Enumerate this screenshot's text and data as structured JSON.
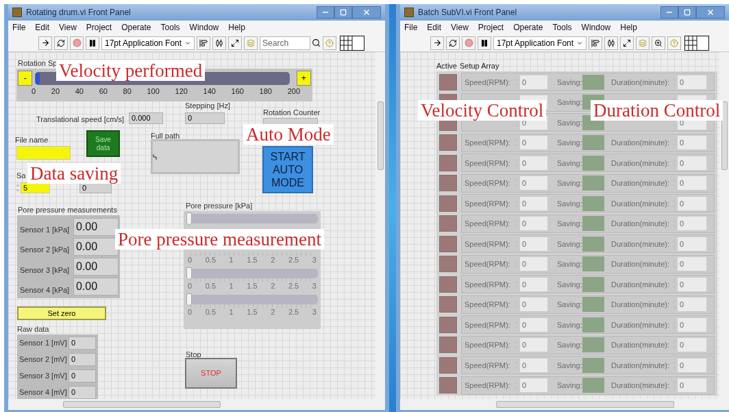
{
  "left_window": {
    "title": "Rotating drum.vi Front Panel",
    "menu": [
      "File",
      "Edit",
      "View",
      "Project",
      "Operate",
      "Tools",
      "Window",
      "Help"
    ],
    "toolbar": {
      "font": "17pt Application Font",
      "search": {
        "placeholder": "Search"
      }
    },
    "rotation_speed": {
      "label": "Rotation Sp",
      "minus": "-",
      "plus": "+",
      "level": 0,
      "ticks": [
        "0",
        "20",
        "40",
        "60",
        "80",
        "100",
        "120",
        "140",
        "160",
        "180",
        "200"
      ]
    },
    "translational_speed": {
      "label": "Translational speed [cm/s]",
      "value": "0.000"
    },
    "stepping": {
      "label": "Stepping [Hz]",
      "value": "0"
    },
    "rotation_counter": {
      "label": "Rotation Counter"
    },
    "file_name": {
      "label": "File name"
    },
    "save_button": "Save data",
    "full_path": {
      "label": "Full path"
    },
    "auto_button": "START AUTO MODE",
    "saves": {
      "label": "Sa",
      "value": "5",
      "value_2": "0"
    },
    "pore_measurements": {
      "title": "Pore pressure measurements",
      "sensors": [
        {
          "label": "Sensor 1 [kPa]",
          "value": "0.00"
        },
        {
          "label": "Sensor 2 [kPa]",
          "value": "0.00"
        },
        {
          "label": "Sensor 3 [kPa]",
          "value": "0.00"
        },
        {
          "label": "Sensor 4 [kPa]",
          "value": "0.00"
        }
      ]
    },
    "pore_pressure": {
      "label": "Pore pressure [kPa]",
      "sliders": [
        {
          "level": 0,
          "ticks": [
            "0",
            "0.5",
            "1",
            "1.5",
            "2",
            "2.5",
            "3"
          ]
        },
        {
          "level": 0,
          "ticks": [
            "0",
            "0.5",
            "1",
            "1.5",
            "2",
            "2.5",
            "3"
          ]
        },
        {
          "level": 0,
          "ticks": [
            "0",
            "0.5",
            "1",
            "1.5",
            "2",
            "2.5",
            "3"
          ]
        }
      ]
    },
    "set_zero": "Set zero",
    "raw_data": {
      "title": "Raw data",
      "sensors": [
        {
          "label": "Sensor 1 [mV]",
          "value": "0"
        },
        {
          "label": "Sensor 2 [mV]",
          "value": "0"
        },
        {
          "label": "Sensor 3 [mV]",
          "value": "0"
        },
        {
          "label": "Sensor 4 [mV]",
          "value": "0"
        }
      ]
    },
    "stop": {
      "label": "Stop",
      "button": "STOP"
    }
  },
  "right_window": {
    "title": "Batch SubVI.vi Front Panel",
    "menu": [
      "File",
      "Edit",
      "View",
      "Project",
      "Operate",
      "Tools",
      "Window",
      "Help"
    ],
    "toolbar": {
      "font": "17pt Application Font"
    },
    "active_label": "Active",
    "array_label": "Setup Array",
    "rows": [
      {
        "active": false,
        "speed_label": "Speed(RPM):",
        "speed_value": "0",
        "saving_label": "Saving:",
        "saving": false,
        "duration_label": "Duration(minute):",
        "duration_value": "0"
      },
      {
        "active": false,
        "saving_label": "Saving:",
        "saving": false
      },
      {
        "active": false,
        "speed_value": "0",
        "saving_label": "Saving:",
        "saving": false,
        "duration_value": "0"
      },
      {
        "active": false,
        "speed_label": "Speed(RPM):",
        "speed_value": "0",
        "saving_label": "Saving:",
        "saving": false,
        "duration_label": "Duration(minute):",
        "duration_value": "0"
      },
      {
        "active": false,
        "speed_label": "Speed(RPM):",
        "speed_value": "0",
        "saving_label": "Saving:",
        "saving": false,
        "duration_label": "Duration(minute):",
        "duration_value": "0"
      },
      {
        "active": false,
        "speed_label": "Speed(RPM):",
        "speed_value": "0",
        "saving_label": "Saving:",
        "saving": false,
        "duration_label": "Duration(minute):",
        "duration_value": "0"
      },
      {
        "active": false,
        "speed_label": "Speed(RPM):",
        "speed_value": "0",
        "saving_label": "Saving:",
        "saving": false,
        "duration_label": "Duration(minute):",
        "duration_value": "0"
      },
      {
        "active": false,
        "speed_label": "Speed(RPM):",
        "speed_value": "0",
        "saving_label": "Saving:",
        "saving": false,
        "duration_label": "Duration(minute):",
        "duration_value": "0"
      },
      {
        "active": false,
        "speed_label": "Speed(RPM):",
        "speed_value": "0",
        "saving_label": "Saving:",
        "saving": false,
        "duration_label": "Duration(minute):",
        "duration_value": "0"
      },
      {
        "active": false,
        "speed_label": "Speed(RPM):",
        "speed_value": "0",
        "saving_label": "Saving:",
        "saving": false,
        "duration_label": "Duration(minute):",
        "duration_value": "0"
      },
      {
        "active": false,
        "speed_label": "Speed(RPM):",
        "speed_value": "0",
        "saving_label": "Saving:",
        "saving": false,
        "duration_label": "Duration(minute):",
        "duration_value": "0"
      },
      {
        "active": false,
        "speed_label": "Speed(RPM):",
        "speed_value": "0",
        "saving_label": "Saving:",
        "saving": false,
        "duration_label": "Duration(minute):",
        "duration_value": "0"
      },
      {
        "active": false,
        "speed_label": "Speed(RPM):",
        "speed_value": "0",
        "saving_label": "Saving:",
        "saving": false,
        "duration_label": "Duration(minute):",
        "duration_value": "0"
      },
      {
        "active": false,
        "speed_label": "Speed(RPM):",
        "speed_value": "0",
        "saving_label": "Saving:",
        "saving": false,
        "duration_label": "Duration(minute):",
        "duration_value": "0"
      },
      {
        "active": false,
        "speed_label": "Speed(RPM):",
        "speed_value": "0",
        "saving_label": "Saving:",
        "saving": false,
        "duration_label": "Duration(minute):",
        "duration_value": "0"
      },
      {
        "active": false,
        "speed_label": "Speed(RPM):",
        "speed_value": "0",
        "saving_label": "Saving:",
        "saving": false,
        "duration_label": "Duration(minute):",
        "duration_value": "0"
      }
    ]
  },
  "annotations": [
    "Velocity performed",
    "Auto Mode",
    "Data saving",
    "Pore pressure measurement",
    "Velocity Control",
    "Duration Control"
  ]
}
